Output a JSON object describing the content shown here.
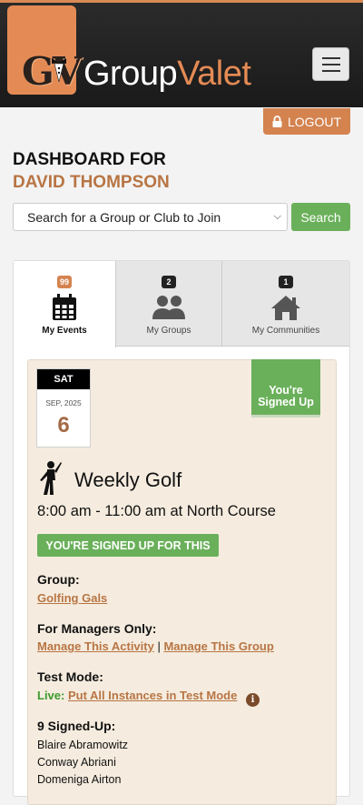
{
  "header": {
    "logo_text": "GV",
    "brand_part1": "Group",
    "brand_part2": "Valet",
    "menu_icon": "hamburger-icon"
  },
  "logout": {
    "label": "LOGOUT",
    "icon": "lock-icon"
  },
  "dashboard": {
    "title_line1": "DASHBOARD FOR",
    "title_line2": "DAVID THOMPSON"
  },
  "search": {
    "select_value": "Search for a Group or Club to Join",
    "button_label": "Search"
  },
  "tabs": [
    {
      "label": "My Events",
      "badge": "99",
      "icon": "calendar-icon",
      "active": true
    },
    {
      "label": "My Groups",
      "badge": "2",
      "icon": "users-icon",
      "active": false
    },
    {
      "label": "My Communities",
      "badge": "1",
      "icon": "home-icon",
      "active": false
    }
  ],
  "event": {
    "day_of_week": "SAT",
    "month_year": "SEP, 2025",
    "day": "6",
    "ribbon_line1": "You're",
    "ribbon_line2": "Signed Up",
    "icon": "golfer-icon",
    "title": "Weekly Golf",
    "time_location": "8:00 am - 11:00 am at North Course",
    "status_badge": "YOU'RE SIGNED UP FOR THIS",
    "group_label": "Group:",
    "group_link": "Golfing Gals",
    "managers_label": "For Managers Only:",
    "manage_activity": "Manage This Activity",
    "separator": "|",
    "manage_group": "Manage This Group",
    "test_mode_label": "Test Mode:",
    "live_label": "Live:",
    "test_mode_link": "Put All Instances in Test Mode",
    "info_icon": "info-icon",
    "signed_up_label": "9 Signed-Up:",
    "signed_up": [
      "Blaire Abramowitz",
      "Conway Abriani",
      "Domeniga Airton"
    ]
  },
  "colors": {
    "accent_orange": "#d4834f",
    "brand_orange": "#e48b55",
    "green": "#6ab05a",
    "link_brown": "#b87544",
    "event_bg": "#f5ecdf"
  }
}
